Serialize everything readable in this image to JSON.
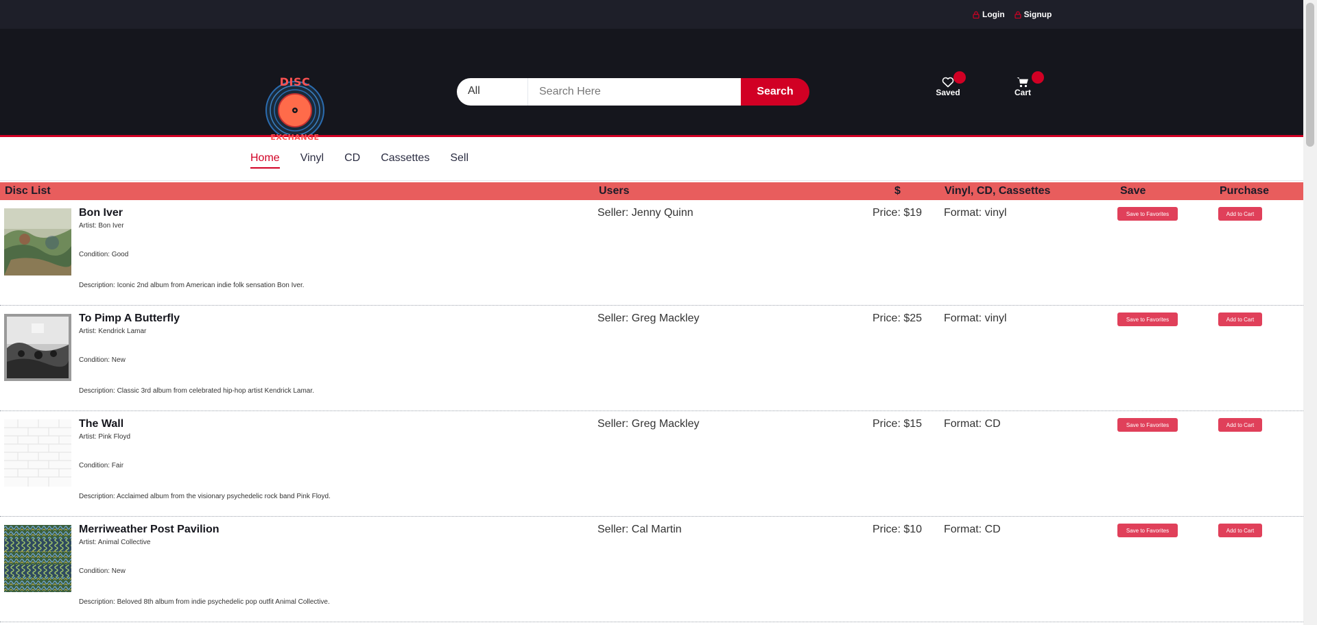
{
  "topbar": {
    "login": "Login",
    "signup": "Signup"
  },
  "header": {
    "logo": {
      "top_text": "DISC",
      "bottom_text": "EXCHANGE"
    },
    "search": {
      "category": "All",
      "placeholder": "Search Here",
      "button": "Search"
    },
    "saved_label": "Saved",
    "cart_label": "Cart"
  },
  "nav": {
    "tabs": [
      "Home",
      "Vinyl",
      "CD",
      "Cassettes",
      "Sell"
    ],
    "active": "Home"
  },
  "table": {
    "headers": {
      "disc_list": "Disc List",
      "users": "Users",
      "price": "$",
      "format": "Vinyl, CD, Cassettes",
      "save": "Save",
      "purchase": "Purchase"
    },
    "save_button": "Save to Favorites",
    "cart_button": "Add to Cart",
    "rows": [
      {
        "title": "Bon Iver",
        "artist": "Artist: Bon Iver",
        "condition": "Condition: Good",
        "description": "Description: Iconic 2nd album from American indie folk sensation Bon Iver.",
        "seller": "Seller: Jenny Quinn",
        "price": "Price: $19",
        "format": "Format: vinyl",
        "art": "landscape-painting"
      },
      {
        "title": "To Pimp A Butterfly",
        "artist": "Artist: Kendrick Lamar",
        "condition": "Condition: New",
        "description": "Description: Classic 3rd album from celebrated hip-hop artist Kendrick Lamar.",
        "seller": "Seller: Greg Mackley",
        "price": "Price: $25",
        "format": "Format: vinyl",
        "art": "bw-crowd-photo"
      },
      {
        "title": "The Wall",
        "artist": "Artist: Pink Floyd",
        "condition": "Condition: Fair",
        "description": "Description: Acclaimed album from the visionary psychedelic rock band Pink Floyd.",
        "seller": "Seller: Greg Mackley",
        "price": "Price: $15",
        "format": "Format: CD",
        "art": "white-brick-wall"
      },
      {
        "title": "Merriweather Post Pavilion",
        "artist": "Artist: Animal Collective",
        "condition": "Condition: New",
        "description": "Description: Beloved 8th album from indie psychedelic pop outfit Animal Collective.",
        "seller": "Seller: Cal Martin",
        "price": "Price: $10",
        "format": "Format: CD",
        "art": "optical-illusion-pattern"
      }
    ]
  },
  "colors": {
    "accent": "#d10024",
    "header_bg": "#15161d",
    "topbar_bg": "#1e1f29",
    "table_header_bg": "#e85d5d",
    "button_bg": "#e0405a"
  }
}
